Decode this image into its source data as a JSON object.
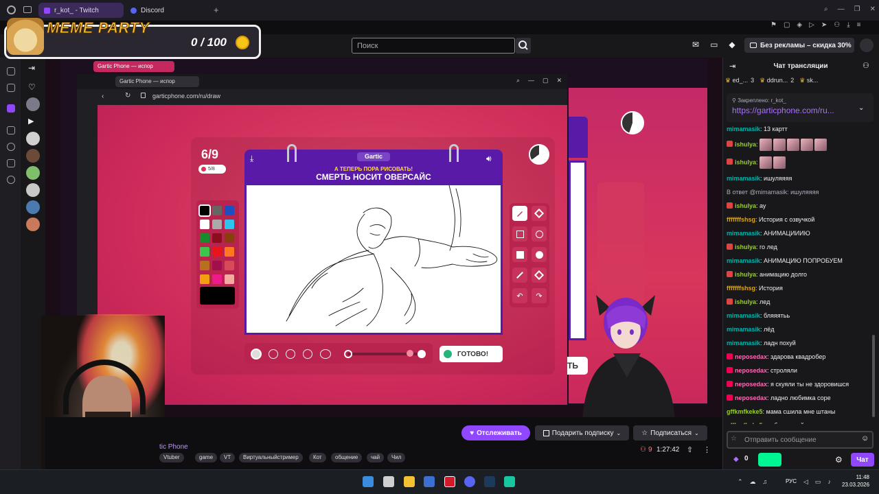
{
  "browser": {
    "tabs": [
      {
        "label": "r_kot_ - Twitch",
        "active": true
      },
      {
        "label": "Discord",
        "active": false
      }
    ]
  },
  "overlay": {
    "title": "MEME PARTY",
    "count": "0 / 100"
  },
  "twitch": {
    "search_placeholder": "Поиск",
    "promo": "Без рекламы – скидка 30%"
  },
  "game_window": {
    "tab_label": "Gartic Phone — испор",
    "url": "garticphone.com/ru/draw",
    "inner_tab_label": "Gartic Phone — испор"
  },
  "game": {
    "round": "6/9",
    "lives": "5/8",
    "logo": "Gartic",
    "subtitle": "А ТЕПЕРЬ ПОРА РИСОВАТЬ!",
    "theme": "СМЕРТЬ НОСИТ ОВЕРСАЙС",
    "done_label": "ГОТОВО!",
    "behind_button_text": "ТЬ",
    "palette": [
      "#000000",
      "#666666",
      "#1e4fc0",
      "#ffffff",
      "#aaaaaa",
      "#2ec4f0",
      "#1a8a2a",
      "#8a0e1e",
      "#8a3e10",
      "#3ec44a",
      "#e8151a",
      "#ff7820",
      "#b87020",
      "#a0104a",
      "#d84a5a",
      "#f2a010",
      "#ee1a8a",
      "#f4aaa0"
    ],
    "colors": {
      "accent": "#5a1aa8",
      "bg": "#cf2c5a",
      "yellow": "#ffd84d"
    }
  },
  "stream_info": {
    "game_name": "tic Phone",
    "tags": [
      "Vtuber",
      "game",
      "VT",
      "Виртуальныйстример",
      "Кот",
      "общение",
      "чай",
      "Чил"
    ],
    "viewers": "9",
    "uptime": "1:27:42",
    "follow_label": "Отслеживать",
    "gift_label": "Подарить подписку",
    "subscribe_label": "Подписаться"
  },
  "chat": {
    "header": "Чат трансляции",
    "viewer_chips": [
      {
        "name": "ed_...",
        "count": "3"
      },
      {
        "name": "ddrun...",
        "count": "2"
      },
      {
        "name": "sk...",
        "count": ""
      }
    ],
    "pinned_label": "Закреплено:",
    "pinned_author": "r_kot_",
    "pinned_link": "https://garticphone.com/ru...",
    "messages": [
      {
        "user": "mimamasik",
        "text": "13 картт",
        "color": "#00b5ad",
        "badge": ""
      },
      {
        "user": "ishulya",
        "text": "",
        "color": "#9acd32",
        "badge": "#d44",
        "emotes": 5
      },
      {
        "user": "ishulya",
        "text": "",
        "color": "#9acd32",
        "badge": "#d44",
        "emotes": 2
      },
      {
        "user": "mimamasik",
        "text": "ишуляяяя",
        "color": "#00b5ad",
        "badge": ""
      },
      {
        "user": "",
        "text": "В ответ @mimamasik: ишуляяяя",
        "color": "#adadb8",
        "badge": "",
        "reply": true
      },
      {
        "user": "ishulya",
        "text": "ау",
        "color": "#9acd32",
        "badge": "#d44"
      },
      {
        "user": "fffffffshsg",
        "text": "История с озвучкой",
        "color": "#daa520",
        "badge": ""
      },
      {
        "user": "mimamasik",
        "text": "АНИМАЦИИИЮ",
        "color": "#00b5ad",
        "badge": ""
      },
      {
        "user": "ishulya",
        "text": "го лед",
        "color": "#9acd32",
        "badge": "#d44"
      },
      {
        "user": "mimamasik",
        "text": "АНИМАЦИЮ ПОПРОБУЕМ",
        "color": "#00b5ad",
        "badge": ""
      },
      {
        "user": "ishulya",
        "text": "анимацию долго",
        "color": "#9acd32",
        "badge": "#d44"
      },
      {
        "user": "fffffffshsg",
        "text": "История",
        "color": "#daa520",
        "badge": ""
      },
      {
        "user": "ishulya",
        "text": "лед",
        "color": "#9acd32",
        "badge": "#d44"
      },
      {
        "user": "mimamasik",
        "text": "бляяятьь",
        "color": "#00b5ad",
        "badge": ""
      },
      {
        "user": "mimamasik",
        "text": "лёд",
        "color": "#00b5ad",
        "badge": ""
      },
      {
        "user": "mimamasik",
        "text": "ладн похуй",
        "color": "#00b5ad",
        "badge": ""
      },
      {
        "user": "neposedax",
        "text": "здарова квадробер",
        "color": "#ff69b4",
        "badge": "#e05"
      },
      {
        "user": "neposedax",
        "text": "строляли",
        "color": "#ff69b4",
        "badge": "#e05"
      },
      {
        "user": "neposedax",
        "text": "я скуяли ты не здоровишся",
        "color": "#ff69b4",
        "badge": "#e05"
      },
      {
        "user": "neposedax",
        "text": "ладно любимка соре",
        "color": "#ff69b4",
        "badge": "#e05"
      },
      {
        "user": "gffkmfkeke5",
        "text": "мама сшила мне штаны",
        "color": "#9acd32",
        "badge": ""
      },
      {
        "user": "gffkmfkeke5",
        "text": "из березовой коры",
        "color": "#9acd32",
        "badge": ""
      }
    ],
    "input_placeholder": "Отправить сообщение",
    "points": "0",
    "send_label": "Чат"
  },
  "taskbar": {
    "lang": "РУС",
    "time": "11:48",
    "date": "23.03.2026"
  }
}
